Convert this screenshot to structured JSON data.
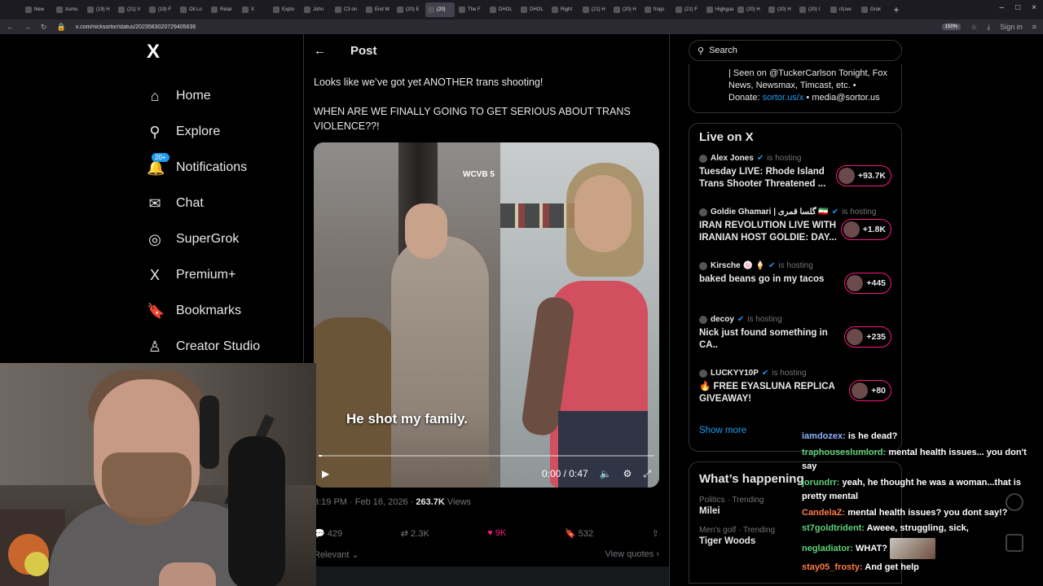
{
  "browser": {
    "tabs": [
      "New",
      "Asmo",
      "(19) H",
      "(21) V",
      "(19) F",
      "Oil Lo",
      "Retar",
      "X",
      "Explo",
      "John",
      "C3 on",
      "End W",
      "(20) E",
      "(20)",
      "The F",
      "DHOL",
      "DHOL",
      "Right",
      "(21) H",
      "(20) H",
      "frogs",
      "(21) F",
      "Highgua",
      "(20) H",
      "(20) H",
      "(20) I",
      "r/Live",
      "Grok"
    ],
    "active_tab_index": 13,
    "url": "x.com/nicksortor/status/2023583020729405636",
    "zoom": "150%",
    "sign_in": "Sign in",
    "new_tab": "+",
    "window_controls": [
      "–",
      "□",
      "×"
    ]
  },
  "nav": {
    "logo": "X",
    "items": [
      {
        "label": "Home",
        "icon": "⌂"
      },
      {
        "label": "Explore",
        "icon": "⚲"
      },
      {
        "label": "Notifications",
        "icon": "🔔",
        "badge": "20+"
      },
      {
        "label": "Chat",
        "icon": "✉"
      },
      {
        "label": "SuperGrok",
        "icon": "◎"
      },
      {
        "label": "Premium+",
        "icon": "X"
      },
      {
        "label": "Bookmarks",
        "icon": "🔖"
      },
      {
        "label": "Creator Studio",
        "icon": "♙"
      }
    ]
  },
  "post": {
    "back": "←",
    "header": "Post",
    "text_line1": "Looks like we’ve got yet ANOTHER trans shooting!",
    "text_line2": "WHEN ARE WE FINALLY GOING TO GET SERIOUS ABOUT TRANS VIOLENCE??!",
    "video": {
      "watermark": "WCVB 5",
      "caption": "He shot my family.",
      "time": "0:00 / 0:47",
      "progress": 0.01
    },
    "time_date": "3:19 PM · Feb 16, 2026",
    "views_count": "263.7K",
    "views_label": "Views",
    "replies": "429",
    "reposts": "2.3K",
    "likes": "9K",
    "bookmarks": "532",
    "sort_label": "Relevant ⌄",
    "view_quotes": "View quotes ›"
  },
  "search": {
    "placeholder": "Search"
  },
  "bio": {
    "line1": "| Seen on @TuckerCarlson Tonight, Fox",
    "line2": "News, Newsmax, Timcast, etc. •",
    "donate_label": "Donate:",
    "donate_link": "sortor.us/x",
    "email": "• media@sortor.us"
  },
  "live": {
    "title": "Live on X",
    "hosting_label": "is hosting",
    "items": [
      {
        "host": "Alex Jones",
        "title": "Tuesday LIVE: Rhode Island Trans Shooter Threatened ...",
        "count": "+93.7K"
      },
      {
        "host": "Goldie Ghamari | گلسا قمری 🇮🇷",
        "title": "IRAN REVOLUTION LIVE WITH IRANIAN HOST GOLDIE: DAY...",
        "count": "+1.8K"
      },
      {
        "host": "Kirsche 🍥 🍦",
        "title": "baked beans go in my tacos",
        "count": "+445"
      },
      {
        "host": "decoy",
        "title": "Nick just found something in CA..",
        "count": "+235"
      },
      {
        "host": "LUCKYY10P",
        "title": "🔥 FREE EYASLUNA REPLICA GIVEAWAY!",
        "count": "+80"
      }
    ],
    "show_more": "Show more"
  },
  "happening": {
    "title": "What’s happening",
    "trends": [
      {
        "category": "Politics · Trending",
        "name": "Milei"
      },
      {
        "category": "Men's golf · Trending",
        "name": "Tiger Woods"
      }
    ]
  },
  "chat": {
    "messages": [
      {
        "user": "iamdozex",
        "color": "#8fb3ff",
        "text": "is he dead?"
      },
      {
        "user": "traphouseslumlord",
        "color": "#5fd17a",
        "text": "mental health issues... you don't say"
      },
      {
        "user": "jorundrr",
        "color": "#5fd17a",
        "text": "yeah, he thought he was a woman...that is pretty mental"
      },
      {
        "user": "CandelaZ",
        "color": "#ff7a45",
        "text": "mental health issues? you dont say!?"
      },
      {
        "user": "st7goldtrident",
        "color": "#5fd17a",
        "text": "Aweee, struggling, sick,"
      },
      {
        "user": "negladiator",
        "color": "#5fd17a",
        "text": "WHAT?"
      },
      {
        "user": "stay05_frosty",
        "color": "#ff7a45",
        "text": "And get help"
      }
    ]
  }
}
